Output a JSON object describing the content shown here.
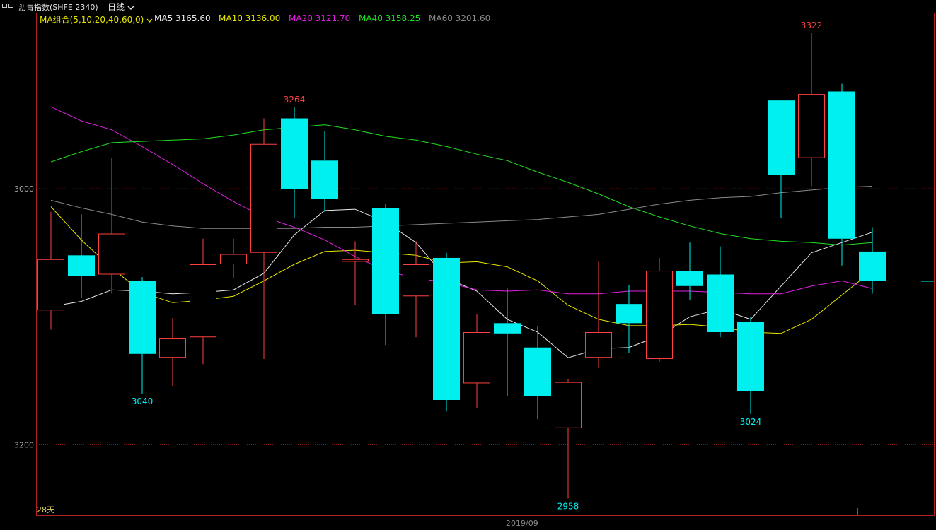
{
  "titlebar": {
    "icon": "window-layout-icon",
    "title": "沥青指数(SHFE 2340)",
    "period": "日线",
    "period_icon": "chevron-down-icon"
  },
  "legend": {
    "combo_label": "MA组合(5,10,20,40,60,0)",
    "combo_icon": "chevron-down-icon",
    "items": [
      {
        "label": "MA5 3165.60",
        "color": "#e8e8e8"
      },
      {
        "label": "MA10 3136.00",
        "color": "#e6e600"
      },
      {
        "label": "MA20 3121.70",
        "color": "#e020e0"
      },
      {
        "label": "MA40 3158.25",
        "color": "#20e020"
      },
      {
        "label": "MA60 3201.60",
        "color": "#8a8a8a"
      }
    ]
  },
  "axis": {
    "y_ticks": [
      "3200",
      "3000"
    ],
    "date_label": "2019/09",
    "days_label": "28天"
  },
  "colors": {
    "up": "#ff4040",
    "down": "#00f0f0",
    "grid": "#8b1a1a",
    "frame": "#b22222"
  },
  "chart_data": {
    "type": "candlestick",
    "ylim": [
      2945,
      3337
    ],
    "ticks": [
      3000,
      3200
    ],
    "annotations": [
      {
        "index": 3,
        "value": 3040,
        "text": "3040",
        "where": "below",
        "color": "#00f0f0"
      },
      {
        "index": 8,
        "value": 3264,
        "text": "3264",
        "where": "above",
        "color": "#ff4040"
      },
      {
        "index": 17,
        "value": 2958,
        "text": "2958",
        "where": "below",
        "color": "#00f0f0"
      },
      {
        "index": 23,
        "value": 3024,
        "text": "3024",
        "where": "below",
        "color": "#00f0f0"
      },
      {
        "index": 25,
        "value": 3322,
        "text": "3322",
        "where": "above",
        "color": "#ff4040"
      }
    ],
    "candles": [
      {
        "o": 3105,
        "h": 3182,
        "l": 3090,
        "c": 3145
      },
      {
        "o": 3148,
        "h": 3180,
        "l": 3115,
        "c": 3132
      },
      {
        "o": 3133,
        "h": 3224,
        "l": 3118,
        "c": 3165
      },
      {
        "o": 3128,
        "h": 3131,
        "l": 3040,
        "c": 3071
      },
      {
        "o": 3068,
        "h": 3099,
        "l": 3046,
        "c": 3083
      },
      {
        "o": 3084,
        "h": 3161,
        "l": 3063,
        "c": 3141
      },
      {
        "o": 3141,
        "h": 3161,
        "l": 3130,
        "c": 3149
      },
      {
        "o": 3150,
        "h": 3255,
        "l": 3067,
        "c": 3235
      },
      {
        "o": 3255,
        "h": 3264,
        "l": 3177,
        "c": 3200
      },
      {
        "o": 3222,
        "h": 3245,
        "l": 3182,
        "c": 3192
      },
      {
        "o": 3143,
        "h": 3159,
        "l": 3109,
        "c": 3145
      },
      {
        "o": 3185,
        "h": 3188,
        "l": 3078,
        "c": 3102
      },
      {
        "o": 3116,
        "h": 3159,
        "l": 3084,
        "c": 3141
      },
      {
        "o": 3146,
        "h": 3150,
        "l": 3026,
        "c": 3035
      },
      {
        "o": 3048,
        "h": 3102,
        "l": 3029,
        "c": 3088
      },
      {
        "o": 3095,
        "h": 3122,
        "l": 3038,
        "c": 3087
      },
      {
        "o": 3076,
        "h": 3093,
        "l": 3020,
        "c": 3038
      },
      {
        "o": 3013,
        "h": 3051,
        "l": 2958,
        "c": 3049
      },
      {
        "o": 3068,
        "h": 3143,
        "l": 3060,
        "c": 3088
      },
      {
        "o": 3110,
        "h": 3125,
        "l": 3072,
        "c": 3095
      },
      {
        "o": 3067,
        "h": 3146,
        "l": 3065,
        "c": 3136
      },
      {
        "o": 3136,
        "h": 3158,
        "l": 3113,
        "c": 3124
      },
      {
        "o": 3133,
        "h": 3155,
        "l": 3084,
        "c": 3088
      },
      {
        "o": 3096,
        "h": 3100,
        "l": 3024,
        "c": 3042
      },
      {
        "o": 3269,
        "h": 3269,
        "l": 3177,
        "c": 3211
      },
      {
        "o": 3224,
        "h": 3322,
        "l": 3202,
        "c": 3274
      },
      {
        "o": 3276,
        "h": 3282,
        "l": 3140,
        "c": 3161
      },
      {
        "o": 3151,
        "h": 3170,
        "l": 3118,
        "c": 3128
      }
    ],
    "series": [
      {
        "name": "MA5",
        "color": "#e8e8e8",
        "values": [
          3108,
          3112,
          3121,
          3120,
          3118,
          3119,
          3121,
          3134,
          3164,
          3183,
          3184,
          3174,
          3158,
          3130,
          3120,
          3098,
          3088,
          3068,
          3075,
          3076,
          3085,
          3100,
          3106,
          3098,
          3124,
          3150,
          3158,
          3166
        ]
      },
      {
        "name": "MA10",
        "color": "#e6e600",
        "values": [
          3186,
          3160,
          3138,
          3119,
          3111,
          3113,
          3116,
          3128,
          3141,
          3151,
          3152,
          3150,
          3148,
          3142,
          3143,
          3139,
          3128,
          3109,
          3098,
          3093,
          3093,
          3094,
          3092,
          3088,
          3087,
          3098,
          3117,
          3136
        ]
      },
      {
        "name": "MA20",
        "color": "#e020e0",
        "values": [
          3264,
          3253,
          3246,
          3233,
          3219,
          3204,
          3190,
          3178,
          3170,
          3160,
          3147,
          3136,
          3130,
          3127,
          3121,
          3120,
          3121,
          3118,
          3118,
          3120,
          3120,
          3120,
          3119,
          3118,
          3118,
          3124,
          3128,
          3122
        ]
      },
      {
        "name": "MA40",
        "color": "#20e020",
        "values": [
          3221,
          3229,
          3236,
          3237,
          3238,
          3239,
          3242,
          3246,
          3248,
          3250,
          3246,
          3241,
          3238,
          3233,
          3227,
          3222,
          3213,
          3205,
          3196,
          3186,
          3178,
          3171,
          3165,
          3161,
          3159,
          3158,
          3156,
          3158
        ]
      },
      {
        "name": "MA60",
        "color": "#8a8a8a",
        "values": [
          3191,
          3185,
          3180,
          3174,
          3171,
          3169,
          3169,
          3169,
          3169,
          3170,
          3170,
          3171,
          3172,
          3173,
          3174,
          3175,
          3176,
          3178,
          3180,
          3184,
          3188,
          3191,
          3193,
          3194,
          3197,
          3199,
          3201,
          3202
        ]
      }
    ]
  }
}
